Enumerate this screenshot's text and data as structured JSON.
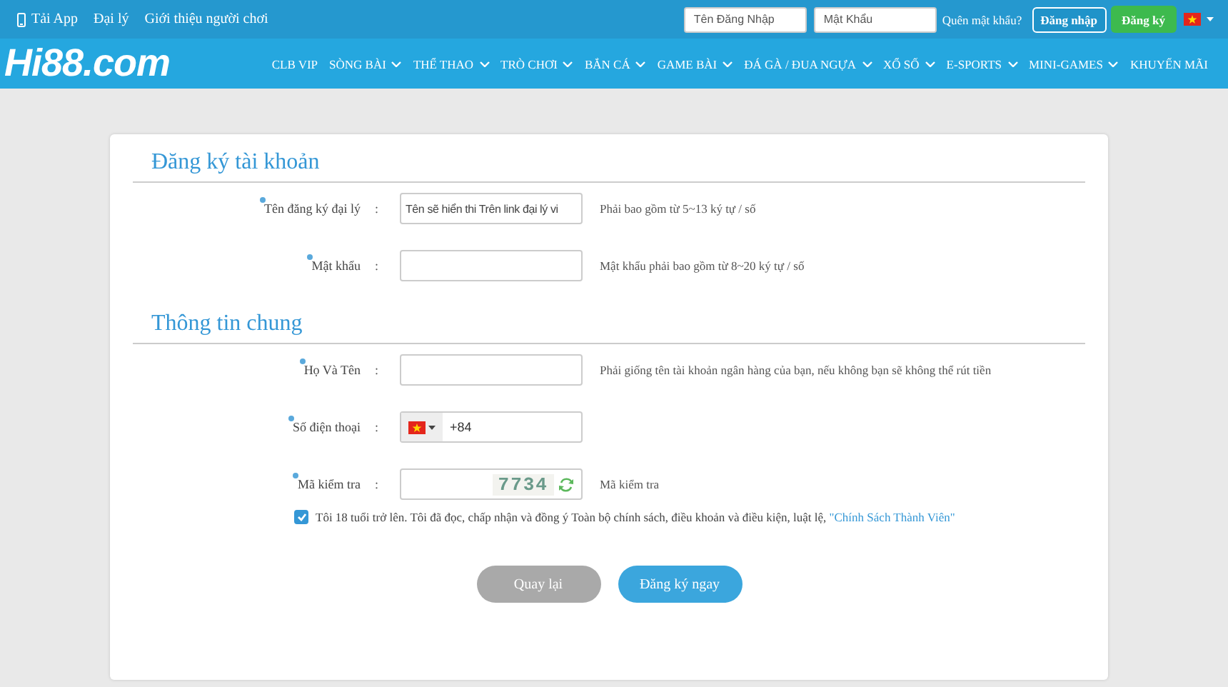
{
  "top_bar": {
    "links": [
      {
        "label": "Tải App",
        "kind": "app"
      },
      {
        "label": "Đại lý",
        "kind": "plain"
      },
      {
        "label": "Giới thiệu người chơi",
        "kind": "plain"
      }
    ],
    "login": {
      "username_placeholder": "Tên Đăng Nhập",
      "password_placeholder": "Mật Khẩu",
      "forgot": "Quên mật khẩu?",
      "login_button": "Đăng nhập",
      "register_button": "Đăng ký"
    }
  },
  "logo": "Hi88.com",
  "nav": [
    {
      "label": "CLB VIP",
      "caret": false
    },
    {
      "label": "SÒNG BÀI",
      "caret": true
    },
    {
      "label": "THỂ THAO",
      "caret": true
    },
    {
      "label": "TRÒ CHƠI",
      "caret": true
    },
    {
      "label": "BẮN CÁ",
      "caret": true
    },
    {
      "label": "GAME BÀI",
      "caret": true
    },
    {
      "label": "ĐÁ GÀ / ĐUA NGỰA",
      "caret": true
    },
    {
      "label": "XỔ SỐ",
      "caret": true
    },
    {
      "label": "E-SPORTS",
      "caret": true
    },
    {
      "label": "MINI-GAMES",
      "caret": true
    },
    {
      "label": "KHUYẾN MÃI",
      "caret": false
    }
  ],
  "sections": [
    {
      "title": "Đăng ký tài khoản",
      "fields": [
        {
          "kind": "text",
          "label": "Tên đăng ký đại lý",
          "separator": ":",
          "required": true,
          "value": "Tên sẽ hiển thi Trên link đại lý vi",
          "hint": "Phải bao gồm từ 5~13 ký tự / số"
        },
        {
          "kind": "text",
          "label": "Mật khẩu",
          "separator": ":",
          "required": true,
          "hint": "Mật khẩu phải bao gồm từ 8~20 ký tự / số"
        }
      ]
    },
    {
      "title": "Thông tin chung",
      "fields": [
        {
          "kind": "text",
          "label": "Họ Và Tên",
          "separator": ":",
          "required": true,
          "hint": "Phải giống tên tài khoản ngân hàng của bạn, nếu không bạn sẽ không thể rút tiền"
        },
        {
          "kind": "phone",
          "label": "Số điện thoại",
          "separator": ":",
          "required": true,
          "value": "+84"
        },
        {
          "kind": "captcha",
          "label": "Mã kiểm tra",
          "separator": ":",
          "required": true,
          "captcha": "7734",
          "hint": "Mã kiểm tra"
        }
      ]
    }
  ],
  "agreement": {
    "checked": true,
    "text": "Tôi 18 tuổi trở lên. Tôi đã đọc, chấp nhận và đồng ý Toàn bộ chính sách, điều khoản và điều kiện, luật lệ,",
    "link": "\"Chính Sách Thành Viên\""
  },
  "buttons": [
    {
      "kind": "back",
      "label": "Quay lại"
    },
    {
      "kind": "submit",
      "label": "Đăng ký ngay"
    }
  ]
}
